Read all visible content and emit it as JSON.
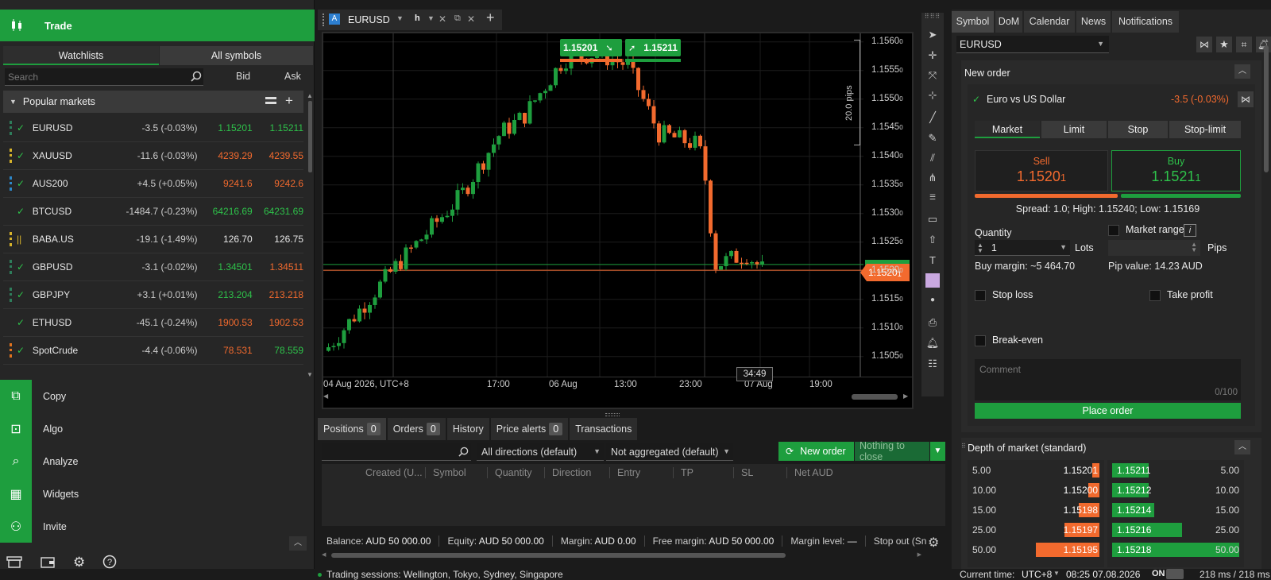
{
  "left": {
    "trade_label": "Trade",
    "tabs": [
      "Watchlists",
      "All symbols"
    ],
    "search_placeholder": "Search",
    "col_bid": "Bid",
    "col_ask": "Ask",
    "popular_label": "Popular markets",
    "rows": [
      {
        "symbol": "EURUSD",
        "change": "-3.5 (-0.03%)",
        "bid": "1.15201",
        "ask": "1.15211",
        "bidColor": "green",
        "askColor": "green",
        "bar": "#2e7d5b",
        "checked": true
      },
      {
        "symbol": "XAUUSD",
        "change": "-11.6 (-0.03%)",
        "bid": "4239.29",
        "ask": "4239.55",
        "bidColor": "orange",
        "askColor": "orange",
        "bar": "#d6b22b",
        "checked": true
      },
      {
        "symbol": "AUS200",
        "change": "+4.5 (+0.05%)",
        "bid": "9241.6",
        "ask": "9242.6",
        "bidColor": "orange",
        "askColor": "orange",
        "bar": "#2d87c9",
        "checked": true
      },
      {
        "symbol": "BTCUSD",
        "change": "-1484.7 (-0.23%)",
        "bid": "64216.69",
        "ask": "64231.69",
        "bidColor": "green",
        "askColor": "green",
        "bar": "",
        "checked": true
      },
      {
        "symbol": "BABA.US",
        "change": "-19.1 (-1.49%)",
        "bid": "126.70",
        "ask": "126.75",
        "bidColor": "plain",
        "askColor": "plain",
        "bar": "#d6b22b",
        "checked": false
      },
      {
        "symbol": "GBPUSD",
        "change": "-3.1 (-0.02%)",
        "bid": "1.34501",
        "ask": "1.34511",
        "bidColor": "green",
        "askColor": "orange",
        "bar": "#2e7d5b",
        "checked": true
      },
      {
        "symbol": "GBPJPY",
        "change": "+3.1 (+0.01%)",
        "bid": "213.204",
        "ask": "213.218",
        "bidColor": "green",
        "askColor": "orange",
        "bar": "#2e7d5b",
        "checked": true
      },
      {
        "symbol": "ETHUSD",
        "change": "-45.1 (-0.24%)",
        "bid": "1900.53",
        "ask": "1902.53",
        "bidColor": "orange",
        "askColor": "orange",
        "bar": "",
        "checked": true
      },
      {
        "symbol": "SpotCrude",
        "change": "-4.4 (-0.06%)",
        "bid": "78.531",
        "ask": "78.559",
        "bidColor": "orange",
        "askColor": "green",
        "bar": "#e0731e",
        "checked": true
      }
    ],
    "nav": [
      "Copy",
      "Algo",
      "Analyze",
      "Widgets",
      "Invite"
    ]
  },
  "chart": {
    "symbol_tab": "EURUSD",
    "timeframe": "h",
    "sell_price": "1.15201",
    "buy_price": "1.15211",
    "pips_label": "20.0 pips",
    "price_tag": "1.1520",
    "price_tag_sub": "1",
    "timer": "34:49",
    "price_axis": [
      "1.1560",
      "1.1555",
      "1.1550",
      "1.1545",
      "1.1540",
      "1.1535",
      "1.1530",
      "1.1525",
      "1.1520",
      "1.1515",
      "1.1510",
      "1.1505"
    ],
    "axis_suffix": "0",
    "time_axis": [
      "04 Aug 2026, UTC+8",
      "17:00",
      "06 Aug",
      "13:00",
      "23:00",
      "07 Aug",
      "19:00"
    ]
  },
  "positions": {
    "tabs": [
      {
        "label": "Positions",
        "count": "0"
      },
      {
        "label": "Orders",
        "count": "0"
      },
      {
        "label": "History",
        "count": ""
      },
      {
        "label": "Price alerts",
        "count": "0"
      },
      {
        "label": "Transactions",
        "count": ""
      }
    ],
    "directions": "All directions (default)",
    "aggregation": "Not aggregated (default)",
    "new_order": "New order",
    "nothing_to_close": "Nothing to close",
    "columns": [
      "Created (U...",
      "Symbol",
      "Quantity",
      "Direction",
      "Entry",
      "TP",
      "SL",
      "Net AUD"
    ],
    "summary": [
      {
        "label": "Balance:",
        "value": "AUD 50 000.00"
      },
      {
        "label": "Equity:",
        "value": "AUD 50 000.00"
      },
      {
        "label": "Margin:",
        "value": "AUD 0.00"
      },
      {
        "label": "Free margin:",
        "value": "AUD 50 000.00"
      },
      {
        "label": "Margin level:",
        "value": "—"
      },
      {
        "label": "Stop out (Sn",
        "value": ""
      }
    ]
  },
  "right": {
    "tabs": [
      "Symbol",
      "DoM",
      "Calendar",
      "News",
      "Notifications"
    ],
    "symbol_select": "EURUSD",
    "new_order_title": "New order",
    "instrument": "Euro vs US Dollar",
    "instrument_change": "-3.5 (-0.03%)",
    "order_types": [
      "Market",
      "Limit",
      "Stop",
      "Stop-limit"
    ],
    "sell_label": "Sell",
    "sell_price": "1.1520",
    "sell_price_sub": "1",
    "buy_label": "Buy",
    "buy_price": "1.1521",
    "buy_price_sub": "1",
    "spread_info": "Spread: 1.0; High: 1.15240; Low: 1.15169",
    "quantity_label": "Quantity",
    "quantity_value": "1",
    "lots_label": "Lots",
    "market_range": "Market range",
    "pips_label": "Pips",
    "buy_margin": "Buy margin: ~5 464.70",
    "pip_value": "Pip value: 14.23 AUD",
    "stop_loss": "Stop loss",
    "take_profit": "Take profit",
    "break_even": "Break-even",
    "comment_placeholder": "Comment",
    "comment_counter": "0/100",
    "place_order": "Place order",
    "dom_title": "Depth of market (standard)",
    "dom_bids": [
      {
        "qty": "5.00",
        "price": "1.15201",
        "fill": 0.11
      },
      {
        "qty": "10.00",
        "price": "1.15200",
        "fill": 0.18
      },
      {
        "qty": "15.00",
        "price": "1.15198",
        "fill": 0.33
      },
      {
        "qty": "25.00",
        "price": "1.15197",
        "fill": 0.55
      },
      {
        "qty": "50.00",
        "price": "1.15195",
        "fill": 1.0
      }
    ],
    "dom_asks": [
      {
        "qty": "5.00",
        "price": "1.15211",
        "fill": 0.11
      },
      {
        "qty": "10.00",
        "price": "1.15212",
        "fill": 0.2
      },
      {
        "qty": "15.00",
        "price": "1.15214",
        "fill": 0.33
      },
      {
        "qty": "25.00",
        "price": "1.15216",
        "fill": 0.55
      },
      {
        "qty": "50.00",
        "price": "1.15218",
        "fill": 1.0
      }
    ]
  },
  "status": {
    "sessions": "Trading sessions: Wellington, Tokyo, Sydney, Singapore",
    "current_time_label": "Current time:",
    "tz": "UTC+8",
    "time": "08:25 07.08.2026",
    "on": "ON",
    "latency": "218 ms / 218 ms"
  },
  "colors": {
    "green": "#1e9e3e",
    "orange": "#f26a2e",
    "bg": "#1b1b1b"
  }
}
